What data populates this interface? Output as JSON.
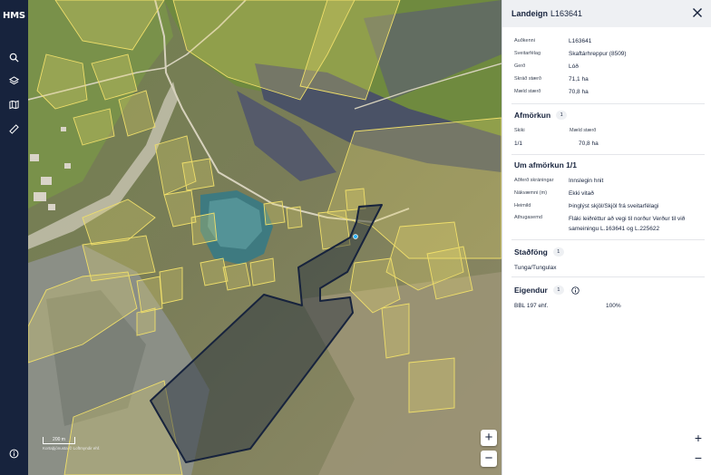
{
  "rail": {
    "logo": "HMS",
    "icons": [
      "search-icon",
      "layers-icon",
      "map-icon",
      "ruler-icon",
      "info-icon"
    ]
  },
  "map": {
    "zoom_in": "+",
    "zoom_out": "−",
    "scale_label": "200 m",
    "attribution": "Kortaþjónusta © Loftmyndir ehf."
  },
  "panel": {
    "title_prefix": "Landeign",
    "title_id": "L163641",
    "details": [
      {
        "label": "Auðkenni",
        "value": "L163641"
      },
      {
        "label": "Sveitarfélag",
        "value": "Skaftárhreppur (8509)"
      },
      {
        "label": "Gerð",
        "value": "Lóð"
      },
      {
        "label": "Skráð stærð",
        "value": "71,1 ha"
      },
      {
        "label": "Mæld stærð",
        "value": "70,8 ha"
      }
    ],
    "afmorkun": {
      "title": "Afmörkun",
      "count": "1",
      "col1": "Skiki",
      "col2": "Mæld stærð",
      "row_skiki": "1/1",
      "row_size": "70,8 ha"
    },
    "um_afmorkun": {
      "title": "Um afmörkun 1/1",
      "rows": [
        {
          "label": "Aðferð skráningar",
          "value": "Innslegin hnit"
        },
        {
          "label": "Nákvæmni (m)",
          "value": "Ekki vitað"
        },
        {
          "label": "Heimild",
          "value": "Þinglýst skjöl/Skjöl frá sveitarfélagi"
        },
        {
          "label": "Athugasemd",
          "value": "Fláki leiðréttur að vegi til norður Verður til við sameiningu L.163641 og L.225622"
        }
      ]
    },
    "stadfong": {
      "title": "Staðföng",
      "count": "1",
      "address": "Tunga/Tungulax"
    },
    "eigendur": {
      "title": "Eigendur",
      "count": "1",
      "owner": "BBL 197 ehf.",
      "share": "100%"
    },
    "zoom_in": "+",
    "zoom_out": "−"
  }
}
